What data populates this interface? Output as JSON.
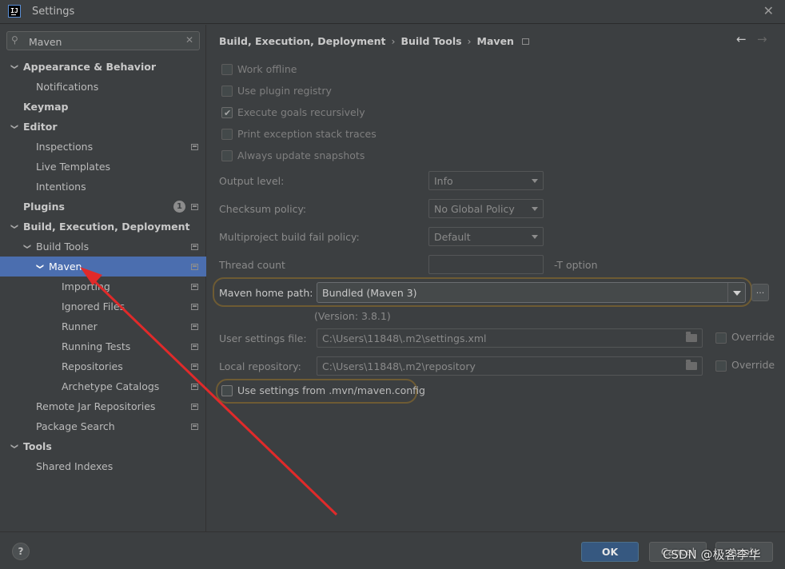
{
  "window": {
    "title": "Settings",
    "app_icon": "IJ"
  },
  "search": {
    "value": "Maven",
    "placeholder": ""
  },
  "tree": [
    {
      "label": "Appearance & Behavior",
      "level": 0,
      "bold": true,
      "expanded": true
    },
    {
      "label": "Notifications",
      "level": 1
    },
    {
      "label": "Keymap",
      "level": 0,
      "bold": true
    },
    {
      "label": "Editor",
      "level": 0,
      "bold": true,
      "expanded": true
    },
    {
      "label": "Inspections",
      "level": 1,
      "proj": true
    },
    {
      "label": "Live Templates",
      "level": 1
    },
    {
      "label": "Intentions",
      "level": 1
    },
    {
      "label": "Plugins",
      "level": 0,
      "bold": true,
      "badge": "1",
      "proj": true
    },
    {
      "label": "Build, Execution, Deployment",
      "level": 0,
      "bold": true,
      "expanded": true
    },
    {
      "label": "Build Tools",
      "level": 1,
      "expanded": true,
      "proj": true
    },
    {
      "label": "Maven",
      "level": 2,
      "expanded": true,
      "proj": true,
      "selected": true
    },
    {
      "label": "Importing",
      "level": 3,
      "proj": true
    },
    {
      "label": "Ignored Files",
      "level": 3,
      "proj": true
    },
    {
      "label": "Runner",
      "level": 3,
      "proj": true
    },
    {
      "label": "Running Tests",
      "level": 3,
      "proj": true
    },
    {
      "label": "Repositories",
      "level": 3,
      "proj": true
    },
    {
      "label": "Archetype Catalogs",
      "level": 3,
      "proj": true
    },
    {
      "label": "Remote Jar Repositories",
      "level": 1,
      "proj": true
    },
    {
      "label": "Package Search",
      "level": 1,
      "proj": true
    },
    {
      "label": "Tools",
      "level": 0,
      "bold": true,
      "expanded": true
    },
    {
      "label": "Shared Indexes",
      "level": 1
    }
  ],
  "breadcrumb": {
    "part1": "Build, Execution, Deployment",
    "part2": "Build Tools",
    "part3": "Maven",
    "sep": "›"
  },
  "checkboxes": {
    "work_offline": {
      "label": "Work offline",
      "checked": false
    },
    "use_plugin_registry": {
      "label": "Use plugin registry",
      "checked": false
    },
    "execute_goals": {
      "label": "Execute goals recursively",
      "checked": true
    },
    "print_exception": {
      "label": "Print exception stack traces",
      "checked": false
    },
    "always_update": {
      "label": "Always update snapshots",
      "checked": false
    }
  },
  "form": {
    "output_level": {
      "label": "Output level:",
      "value": "Info"
    },
    "checksum_policy": {
      "label": "Checksum policy:",
      "value": "No Global Policy"
    },
    "multiproject_fail": {
      "label": "Multiproject build fail policy:",
      "value": "Default"
    },
    "thread_count": {
      "label": "Thread count",
      "value": "",
      "hint": "-T option"
    },
    "maven_home": {
      "label": "Maven home path:",
      "value": "Bundled (Maven 3)",
      "version": "(Version: 3.8.1)",
      "browse": "..."
    },
    "user_settings": {
      "label": "User settings file:",
      "value": "C:\\Users\\11848\\.m2\\settings.xml",
      "override": "Override"
    },
    "local_repo": {
      "label": "Local repository:",
      "value": "C:\\Users\\11848\\.m2\\repository",
      "override": "Override"
    },
    "mvn_config": {
      "label": "Use settings from .mvn/maven.config",
      "checked": false
    }
  },
  "footer": {
    "help": "?",
    "ok": "OK",
    "cancel": "Cancel",
    "apply": "Apply",
    "watermark": "CSDN @极客李华"
  },
  "colors": {
    "accent": "#4b6eaf",
    "highlight_oval": "#6e5b33",
    "annotation_arrow": "#e02a2a"
  }
}
